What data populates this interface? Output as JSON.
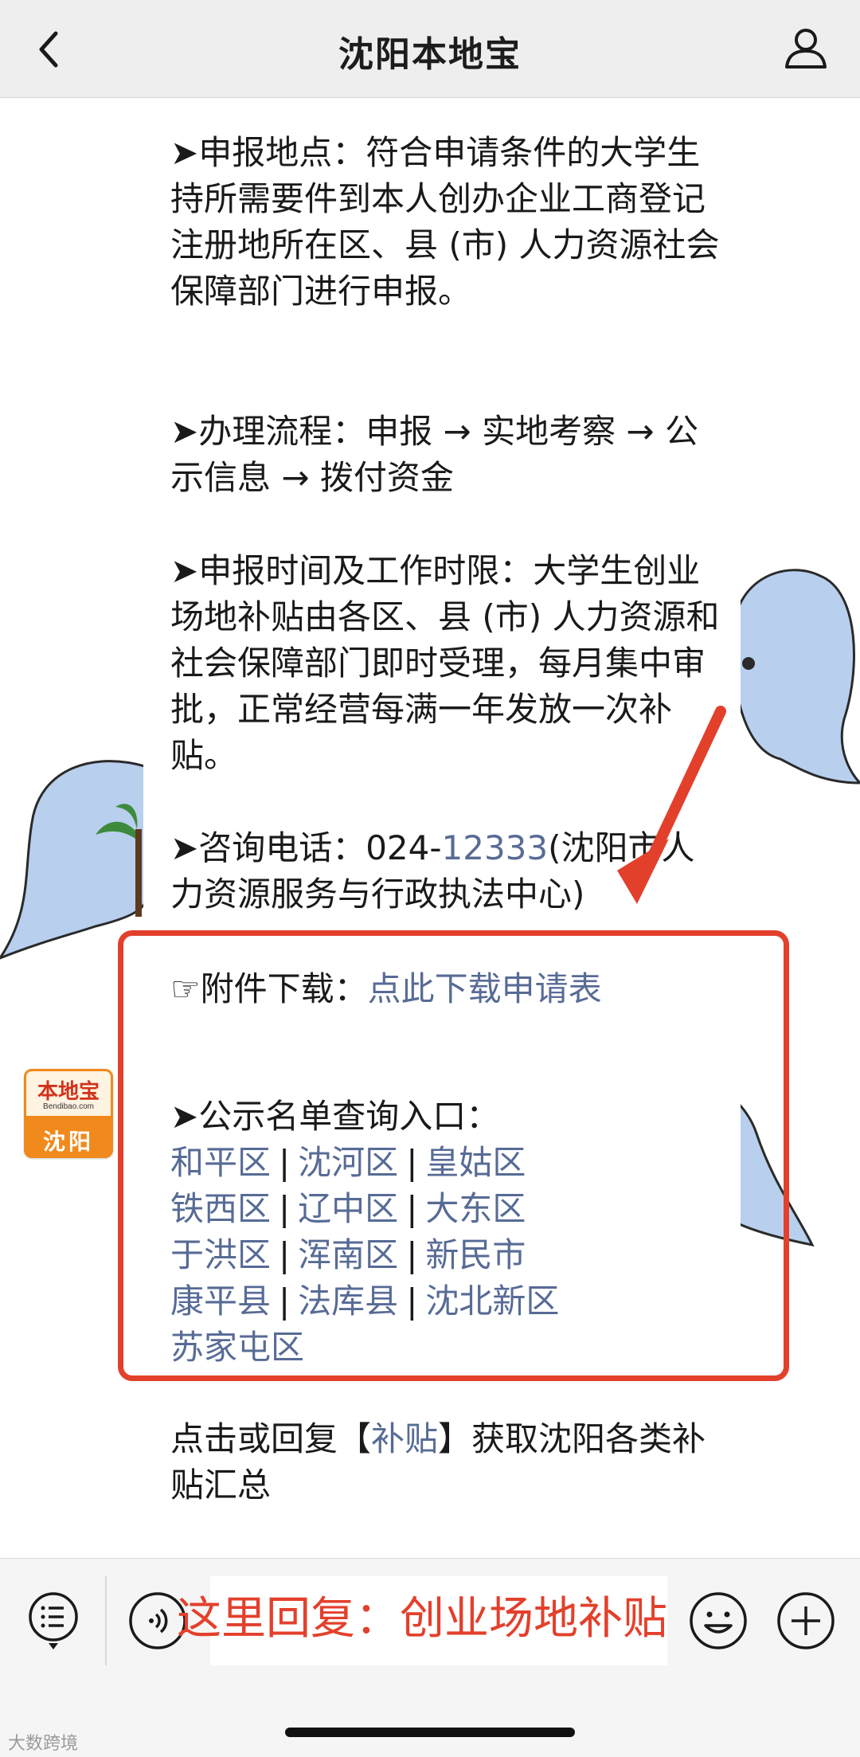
{
  "header": {
    "title": "沈阳本地宝"
  },
  "article": {
    "location_text": "➤申报地点：符合申请条件的大学生持所需要件到本人创办企业工商登记注册地所在区、县 (市) 人力资源社会保障部门进行申报。",
    "process_text": "➤办理流程：申报 → 实地考察 → 公示信息 → 拨付资金",
    "time_text": "➤申报时间及工作时限：大学生创业场地补贴由各区、县 (市) 人力资源和社会保障部门即时受理，每月集中审批，正常经营每满一年发放一次补贴。",
    "phone_prefix": "➤咨询电话：024-",
    "phone_number": "12333",
    "phone_suffix": "(沈阳市人力资源服务与行政执法中心)",
    "attachment_label": "☞附件下载：",
    "attachment_link": "点此下载申请表",
    "query_title": "➤公示名单查询入口：",
    "districts": [
      "和平区",
      "沈河区",
      "皇姑区",
      "铁西区",
      "辽中区",
      "大东区",
      "于洪区",
      "浑南区",
      "新民市",
      "康平县",
      "法库县",
      "沈北新区",
      "苏家屯区"
    ],
    "separator": "|",
    "footer_prefix": "点击或回复【",
    "footer_keyword": "补贴",
    "footer_suffix": "】获取沈阳各类补贴汇总"
  },
  "logo": {
    "main": "本地宝",
    "sub": "Bendibao.com",
    "city": "沈阳"
  },
  "bottom": {
    "annotation": "这里回复：创业场地补贴",
    "watermark": "大数跨境"
  },
  "colors": {
    "link": "#576b95",
    "highlight": "#e3402c",
    "logo": "#f08a1c"
  }
}
